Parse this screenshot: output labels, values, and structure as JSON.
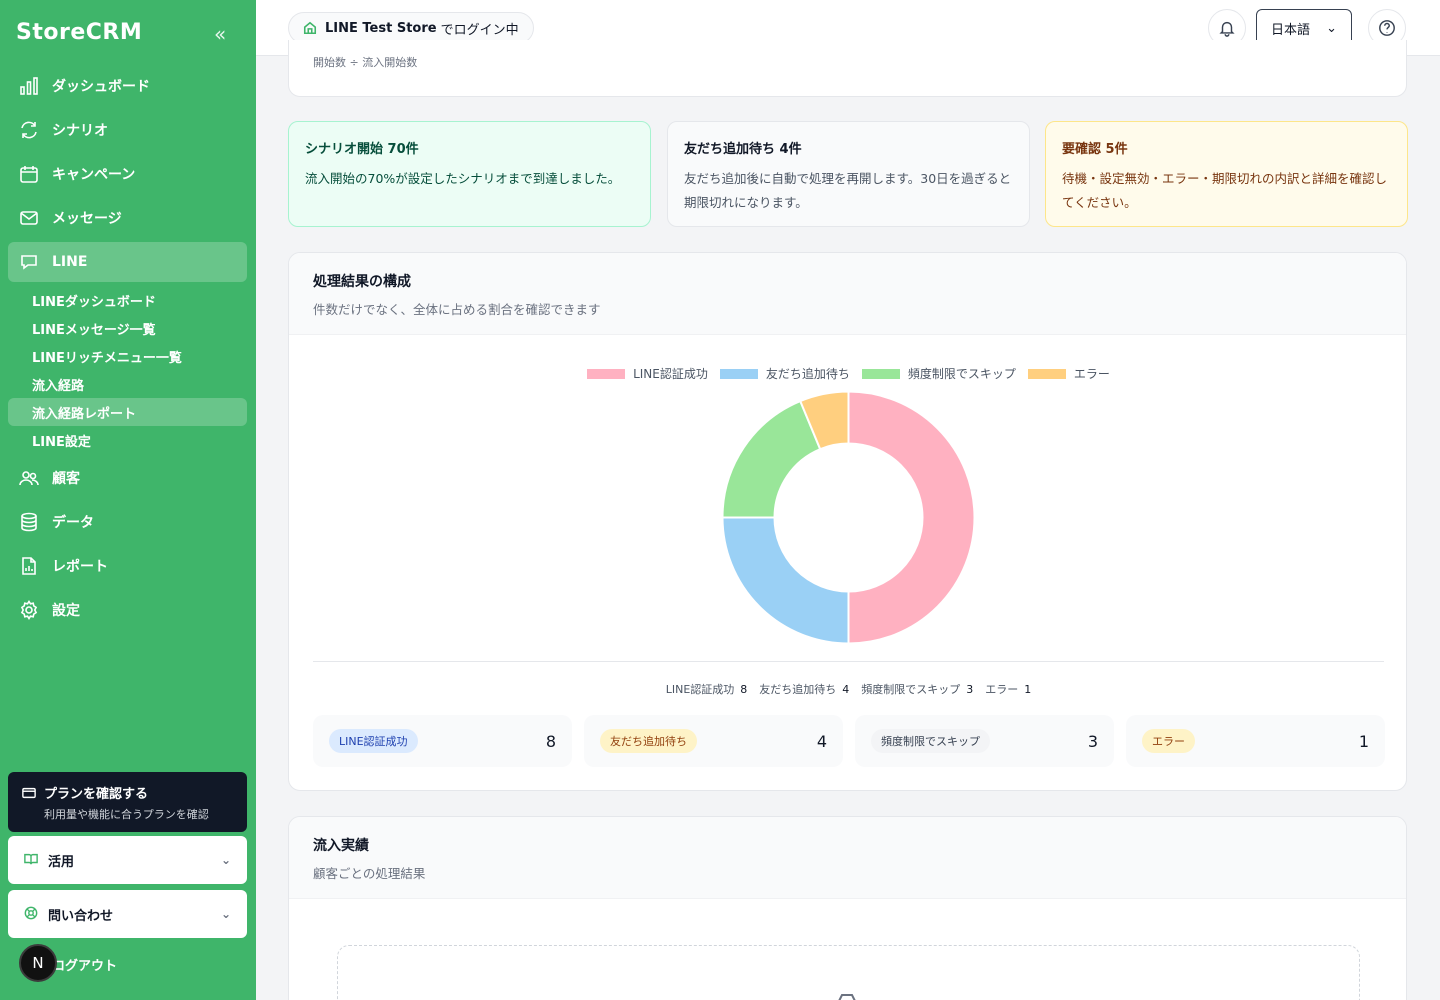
{
  "sidebar": {
    "brand": "StoreCRM",
    "nav": [
      {
        "label": "ダッシュボード",
        "icon": "bar-chart-icon"
      },
      {
        "label": "シナリオ",
        "icon": "refresh-icon"
      },
      {
        "label": "キャンペーン",
        "icon": "calendar-icon"
      },
      {
        "label": "メッセージ",
        "icon": "mail-icon"
      },
      {
        "label": "LINE",
        "icon": "chat-icon",
        "active": true
      }
    ],
    "line_sub": [
      {
        "label": "LINEダッシュボード"
      },
      {
        "label": "LINEメッセージ一覧"
      },
      {
        "label": "LINEリッチメニュー一覧"
      },
      {
        "label": "流入経路"
      },
      {
        "label": "流入経路レポート",
        "active": true
      },
      {
        "label": "LINE設定"
      }
    ],
    "nav2": [
      {
        "label": "顧客",
        "icon": "users-icon"
      },
      {
        "label": "データ",
        "icon": "database-icon"
      },
      {
        "label": "レポート",
        "icon": "file-report-icon"
      },
      {
        "label": "設定",
        "icon": "gear-icon"
      }
    ],
    "plan": {
      "title": "プランを確認する",
      "sub": "利用量や機能に合うプランを確認"
    },
    "usage": "活用",
    "contact": "問い合わせ",
    "logout": "ログアウト",
    "avatar": "N"
  },
  "header": {
    "store": "LINE Test Store",
    "store_suffix": "でログイン中",
    "lang": "日本語"
  },
  "top_card": {
    "formula": "開始数 ÷ 流入開始数"
  },
  "stats": [
    {
      "title": "シナリオ開始 70件",
      "body": "流入開始の70%が設定したシナリオまで到達しました。"
    },
    {
      "title": "友だち追加待ち 4件",
      "body": "友だち追加後に自動で処理を再開します。30日を過ぎると期限切れになります。"
    },
    {
      "title": "要確認 5件",
      "body": "待機・設定無効・エラー・期限切れの内訳と詳細を確認してください。"
    }
  ],
  "composition": {
    "title": "処理結果の構成",
    "subtitle": "件数だけでなく、全体に占める割合を確認できます"
  },
  "chart_data": {
    "type": "pie",
    "donut": true,
    "categories": [
      "LINE認証成功",
      "友だち追加待ち",
      "頻度制限でスキップ",
      "エラー"
    ],
    "values": [
      8,
      4,
      3,
      1
    ],
    "colors": [
      "#ffb1c1",
      "#9ad0f5",
      "#99e699",
      "#ffcf7f"
    ],
    "legend": "top"
  },
  "tiles": [
    {
      "label": "LINE認証成功",
      "value": "8",
      "bg": "#dbeafe",
      "fg": "#1e40af"
    },
    {
      "label": "友だち追加待ち",
      "value": "4",
      "bg": "#fef3c7",
      "fg": "#92400e"
    },
    {
      "label": "頻度制限でスキップ",
      "value": "3",
      "bg": "#f3f4f6",
      "fg": "#374151"
    },
    {
      "label": "エラー",
      "value": "1",
      "bg": "#fef3c7",
      "fg": "#92400e"
    }
  ],
  "flow": {
    "title": "流入実績",
    "subtitle": "顧客ごとの処理結果"
  }
}
